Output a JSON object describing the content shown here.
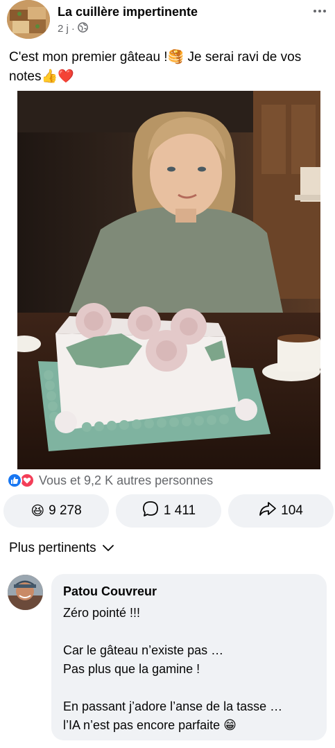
{
  "post": {
    "page_name": "La cuillère impertinente",
    "time": "2 j",
    "separator": "·",
    "audience_icon": "globe-icon",
    "text_line1": "C'est mon premier gâteau !",
    "text_line1_cont": " Je serai ravi de vos",
    "text_line2": "notes",
    "emojis": {
      "cake": "🥞",
      "thumbs": "👍",
      "heart": "❤️"
    }
  },
  "photo": {
    "subject": "girl-with-cake-photo"
  },
  "reactions": {
    "summary": "Vous et 9,2 K autres personnes",
    "icons": [
      "like-icon",
      "love-icon"
    ]
  },
  "actions": {
    "react_count": "9 278",
    "react_emoji": "😆",
    "comment_count": "1 411",
    "share_count": "104"
  },
  "sort": {
    "label": "Plus pertinents"
  },
  "comment": {
    "author": "Patou Couvreur",
    "text": "Zéro pointé !!!\n\nCar le gâteau n’existe pas …\nPas plus que la gamine !\n\nEn passant j’adore l’anse de la tasse …\nl’IA n’est pas encore parfaite",
    "emoji": "😁"
  },
  "colors": {
    "secondary_text": "#65676b",
    "button_bg": "#f0f2f5",
    "like_blue": "#1877f2",
    "love_red": "#f33e58"
  }
}
